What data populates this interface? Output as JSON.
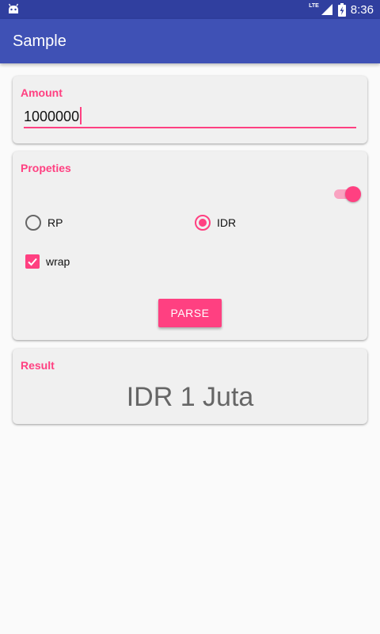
{
  "status_bar": {
    "time": "8:36",
    "network_label": "LTE",
    "left_icon": "android-notification-icon",
    "signal_icon": "signal-icon",
    "battery_icon": "battery-charging-icon"
  },
  "app_bar": {
    "title": "Sample"
  },
  "amount_card": {
    "label": "Amount",
    "value": "1000000"
  },
  "properties_card": {
    "label": "Propeties",
    "toggle_on": true,
    "radio_options": [
      {
        "label": "RP",
        "checked": false
      },
      {
        "label": "IDR",
        "checked": true
      }
    ],
    "checkbox": {
      "label": "wrap",
      "checked": true
    },
    "parse_label": "PARSE"
  },
  "result_card": {
    "label": "Result",
    "value": "IDR 1 Juta"
  },
  "colors": {
    "primary": "#3F51B5",
    "primary_dark": "#303F9F",
    "accent": "#FF4081",
    "background": "#fafafa",
    "card": "#f0f0f0"
  }
}
